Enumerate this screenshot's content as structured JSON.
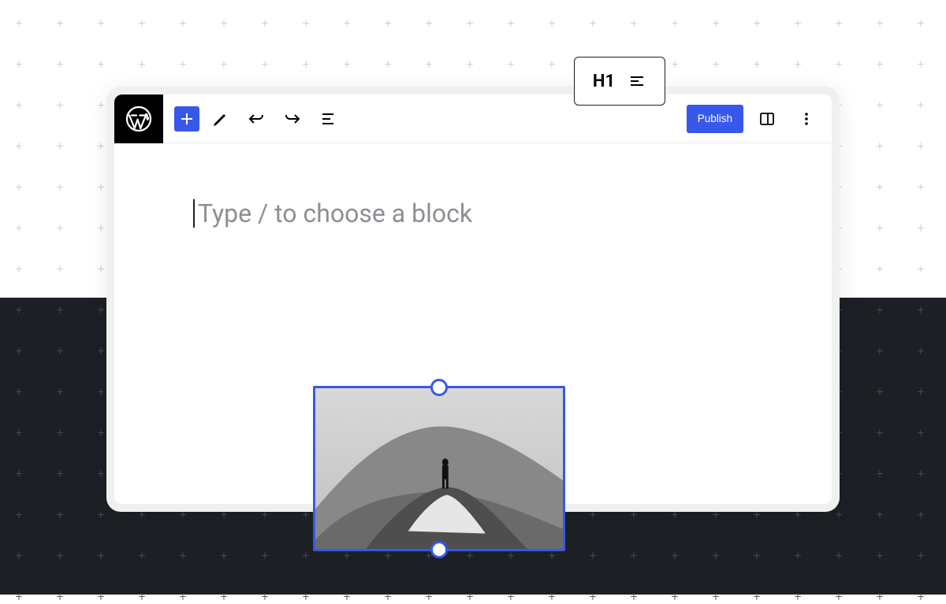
{
  "toolbar": {
    "add_label": "Add block",
    "edit_label": "Tools",
    "undo_label": "Undo",
    "redo_label": "Redo",
    "outline_label": "Document overview",
    "publish_label": "Publish",
    "sidebar_label": "Settings",
    "more_label": "Options"
  },
  "editor": {
    "placeholder": "Type / to choose a block"
  },
  "popover": {
    "heading_level": "H1",
    "align_label": "Align"
  },
  "image_block": {
    "description": "Mountain landscape photograph",
    "selected": true
  },
  "colors": {
    "accent": "#3858e9",
    "dark_bg": "#1c2024"
  }
}
